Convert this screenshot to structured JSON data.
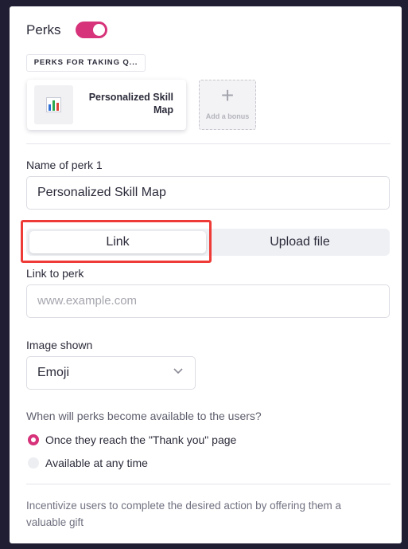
{
  "perks": {
    "title": "Perks",
    "toggle_on": true
  },
  "chip": {
    "label": "PERKS FOR TAKING Q..."
  },
  "perk_card": {
    "name": "Personalized Skill Map",
    "icon": "bar-chart-emoji"
  },
  "add_bonus": {
    "label": "Add a bonus"
  },
  "name_field": {
    "label": "Name of perk 1",
    "value": "Personalized Skill Map"
  },
  "segment": {
    "options": [
      "Link",
      "Upload file"
    ],
    "selected": "Link"
  },
  "link_field": {
    "label": "Link to perk",
    "placeholder": "www.example.com"
  },
  "image_field": {
    "label": "Image shown",
    "value": "Emoji"
  },
  "availability": {
    "question": "When will perks become available to the users?",
    "options": [
      {
        "label": "Once they reach the \"Thank you\" page",
        "selected": true
      },
      {
        "label": "Available at any time",
        "selected": false
      }
    ]
  },
  "footer": {
    "text": "Incentivize users to complete the desired action by offering them a valuable gift"
  },
  "colors": {
    "accent": "#d6337a",
    "highlight": "#ee3b37"
  }
}
